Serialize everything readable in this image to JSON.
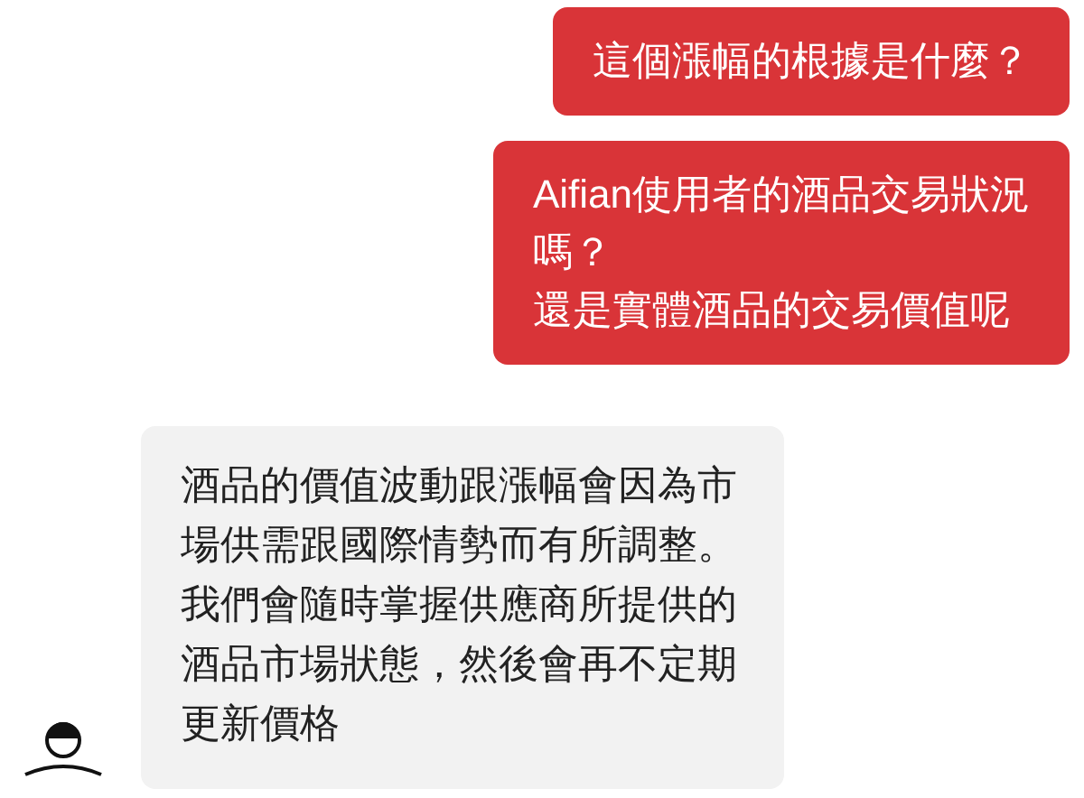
{
  "messages": [
    {
      "kind": "sent",
      "lines": [
        "這個漲幅的根據是什麼？"
      ]
    },
    {
      "kind": "sent",
      "lines": [
        "Aifian使用者的酒品交易狀況",
        "嗎？",
        "還是實體酒品的交易價值呢"
      ]
    },
    {
      "kind": "received",
      "lines": [
        "酒品的價值波動跟漲幅會因為市",
        "場供需跟國際情勢而有所調整。",
        "我們會隨時掌握供應商所提供的",
        "酒品市場狀態，然後會再不定期",
        "更新價格"
      ]
    }
  ]
}
